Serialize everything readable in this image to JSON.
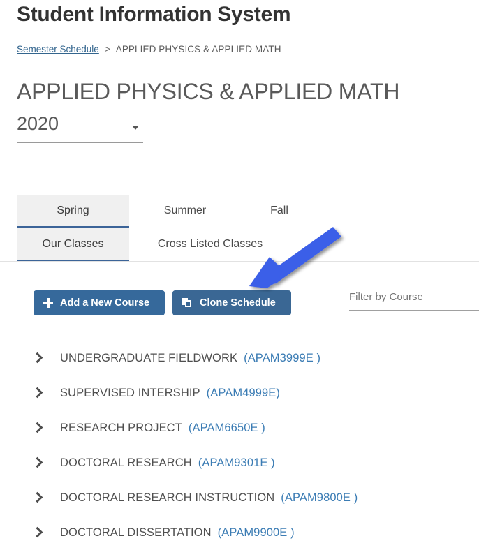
{
  "app": {
    "title": "Student Information System"
  },
  "breadcrumb": {
    "link_label": "Semester Schedule",
    "separator": ">",
    "current": "APPLIED PHYSICS & APPLIED MATH"
  },
  "page": {
    "title": "APPLIED PHYSICS & APPLIED MATH"
  },
  "year_select": {
    "value": "2020",
    "caret_icon": "chevron-down-icon"
  },
  "tabs": {
    "primary": [
      {
        "label": "Spring",
        "active": true
      },
      {
        "label": "Summer",
        "active": false
      },
      {
        "label": "Fall",
        "active": false
      }
    ],
    "secondary": [
      {
        "label": "Our Classes",
        "active": true
      },
      {
        "label": "Cross Listed Classes",
        "active": false
      }
    ]
  },
  "toolbar": {
    "add_course_label": "Add a New Course",
    "add_course_icon": "plus-icon",
    "clone_schedule_label": "Clone Schedule",
    "clone_schedule_icon": "copy-icon"
  },
  "filter": {
    "placeholder": "Filter by Course",
    "value": ""
  },
  "courses": [
    {
      "name": "UNDERGRADUATE FIELDWORK",
      "code": "(APAM3999E )"
    },
    {
      "name": "SUPERVISED INTERSHIP",
      "code": "(APAM4999E)"
    },
    {
      "name": "RESEARCH PROJECT",
      "code": "(APAM6650E )"
    },
    {
      "name": "DOCTORAL RESEARCH",
      "code": "(APAM9301E )"
    },
    {
      "name": "DOCTORAL RESEARCH INSTRUCTION",
      "code": "(APAM9800E )"
    },
    {
      "name": "DOCTORAL DISSERTATION",
      "code": "(APAM9900E )"
    }
  ],
  "annotation": {
    "type": "arrow",
    "color": "#3b5ee8",
    "points_to": "clone-schedule-button"
  },
  "colors": {
    "primary_button": "#36699b",
    "tab_active_underline": "#3c6498",
    "link": "#33658e",
    "course_code": "#3b7cb4",
    "annotation_arrow": "#3b5ee8"
  }
}
